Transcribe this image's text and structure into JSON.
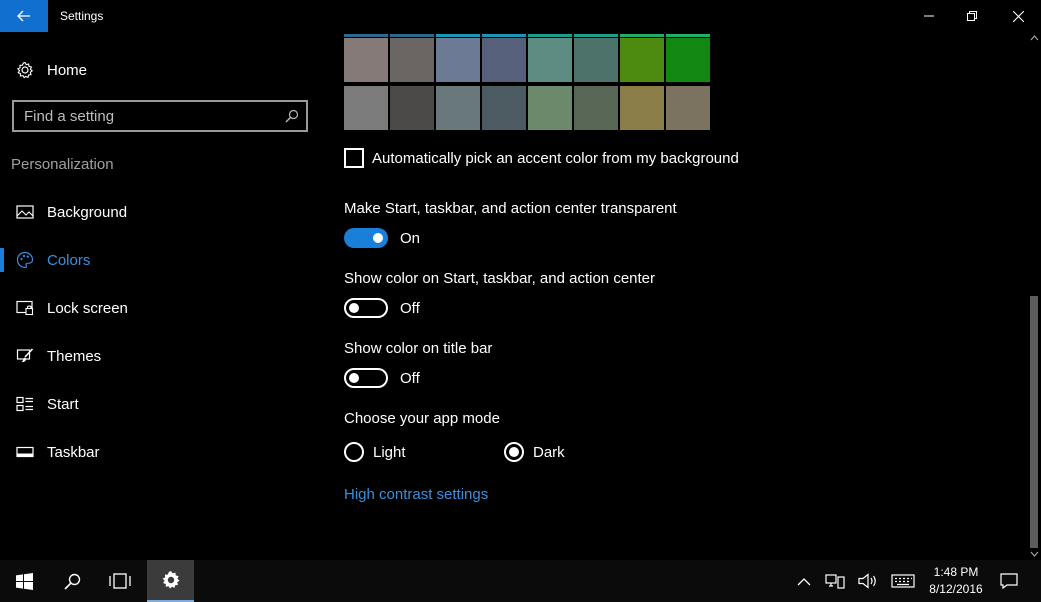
{
  "window": {
    "title": "Settings",
    "controls": [
      "minimize-icon",
      "restore-icon",
      "close-icon"
    ]
  },
  "sidebar": {
    "home_label": "Home",
    "search_placeholder": "Find a setting",
    "section_label": "Personalization",
    "items": [
      {
        "label": "Background",
        "icon": "picture-icon",
        "selected": false
      },
      {
        "label": "Colors",
        "icon": "palette-icon",
        "selected": true
      },
      {
        "label": "Lock screen",
        "icon": "lock-screen-icon",
        "selected": false
      },
      {
        "label": "Themes",
        "icon": "brush-icon",
        "selected": false
      },
      {
        "label": "Start",
        "icon": "start-grid-icon",
        "selected": false
      },
      {
        "label": "Taskbar",
        "icon": "taskbar-icon",
        "selected": false
      }
    ]
  },
  "colors": {
    "accent": "#1a7fd9",
    "swatch_rows": [
      [
        "#867a79",
        "#6b6563",
        "#6d7a96",
        "#56607a",
        "#5d8c82",
        "#4d7269",
        "#4c8a10",
        "#128812"
      ],
      [
        "#7b7b7b",
        "#4b4a48",
        "#68787b",
        "#4c5a62",
        "#6c8a6b",
        "#586656",
        "#8a7d47",
        "#7c7260"
      ]
    ],
    "swatch_top_lines": [
      "#2b6a8c",
      "#2b6a8c",
      "#1697b4",
      "#1697b4",
      "#1a9e8e",
      "#1a9e8e",
      "#1faf6a",
      "#1faf6a"
    ]
  },
  "content": {
    "auto_accent_label": "Automatically pick an accent color from my background",
    "auto_accent_checked": false,
    "transparent": {
      "label": "Make Start, taskbar, and action center transparent",
      "state": "On"
    },
    "show_color_start": {
      "label": "Show color on Start, taskbar, and action center",
      "state": "Off"
    },
    "show_color_title": {
      "label": "Show color on title bar",
      "state": "Off"
    },
    "app_mode": {
      "label": "Choose your app mode",
      "options": [
        "Light",
        "Dark"
      ],
      "selected": "Dark"
    },
    "high_contrast_link": "High contrast settings"
  },
  "taskbar": {
    "buttons": [
      "windows-start-icon",
      "search-icon",
      "task-view-icon",
      "settings-gear-icon"
    ],
    "tray_icons": [
      "chevron-up-icon",
      "network-icon",
      "volume-icon",
      "keyboard-icon"
    ],
    "time": "1:48 PM",
    "date": "8/12/2016"
  }
}
